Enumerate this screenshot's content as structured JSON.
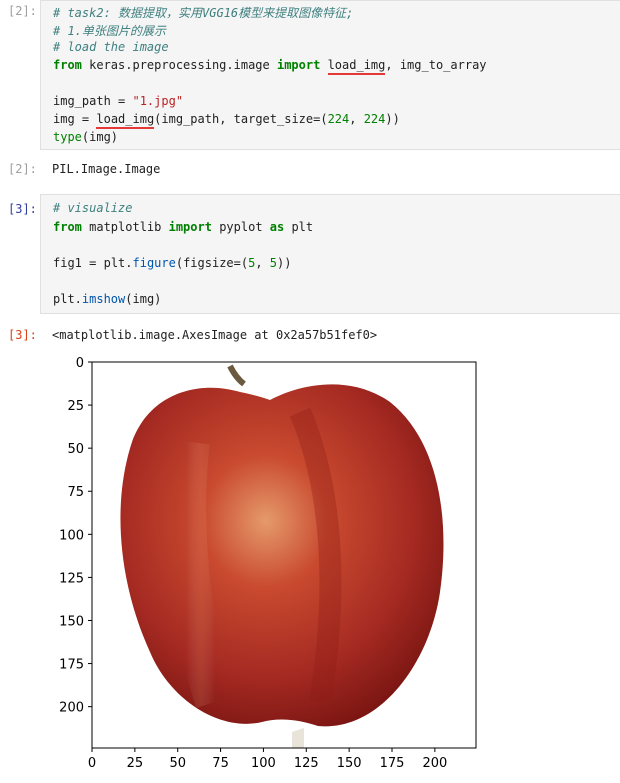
{
  "cells": {
    "c2_in": {
      "prompt": "[2]:",
      "lines": [
        {
          "comment": "# task2: 数据提取，实用VGG16模型来提取图像特征;"
        },
        {
          "comment": "# 1.单张图片的展示"
        },
        {
          "comment": "# load the image"
        },
        {
          "kw1": "from",
          "mod": " keras.preprocessing.image ",
          "kw2": "import",
          "a": " ",
          "fn1": "load_img",
          "rest": ", img_to_array"
        },
        {
          "empty": ""
        },
        {
          "var": "img_path",
          "op": " = ",
          "str": "\"1.jpg\""
        },
        {
          "var": "img",
          "op": " = ",
          "fn1": "load_img",
          "rest": "(img_path, target_size=(",
          "n1": "224",
          "c": ", ",
          "n2": "224",
          "end": "))"
        },
        {
          "bi": "type",
          "rest": "(img)"
        }
      ]
    },
    "c2_out": {
      "prompt": "[2]:",
      "text": "PIL.Image.Image"
    },
    "c3_in": {
      "prompt": "[3]:",
      "comment": "# visualize",
      "import": {
        "kw1": "from",
        "mod": " matplotlib ",
        "kw2": "import",
        "mid": " pyplot ",
        "kw3": "as",
        "alias": " plt"
      },
      "fig": {
        "var": "fig1",
        "op": " = ",
        "obj": "plt.",
        "fn": "figure",
        "rest": "(figsize=(",
        "n1": "5",
        "c": ", ",
        "n2": "5",
        "end": "))"
      },
      "show": {
        "obj": "plt.",
        "fn": "imshow",
        "rest": "(img)"
      }
    },
    "c3_out": {
      "prompt": "[3]:",
      "text": "<matplotlib.image.AxesImage at 0x2a57b51fef0>"
    }
  },
  "chart_data": {
    "type": "image",
    "title": "",
    "xlabel": "",
    "ylabel": "",
    "xlim": [
      0,
      224
    ],
    "ylim": [
      224,
      0
    ],
    "xticks": [
      "0",
      "25",
      "50",
      "75",
      "100",
      "125",
      "150",
      "175",
      "200"
    ],
    "yticks": [
      "0",
      "25",
      "50",
      "75",
      "100",
      "125",
      "150",
      "175",
      "200"
    ],
    "image_content": "red apple",
    "colors": {
      "apple_dark": "#8e1c18",
      "apple_mid": "#c0392b",
      "apple_light": "#e07a4a",
      "stem": "#6b5a40"
    }
  }
}
